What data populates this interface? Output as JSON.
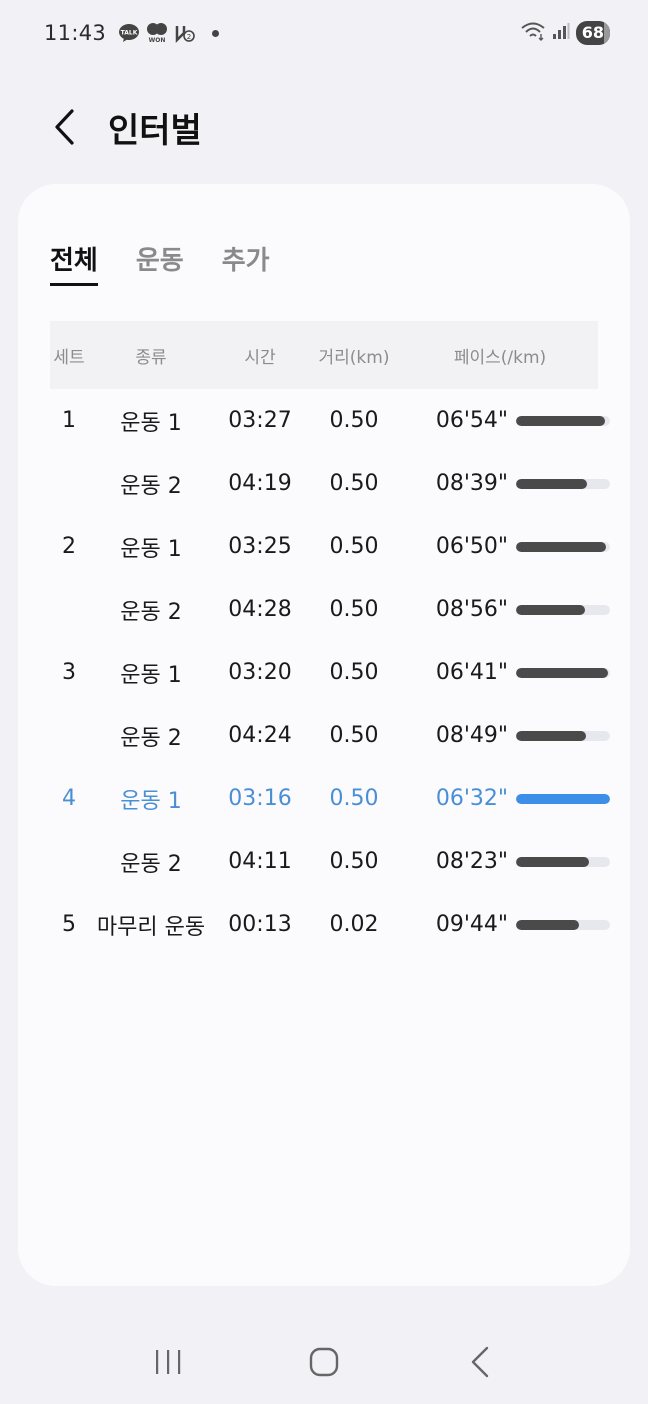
{
  "status_bar": {
    "time": "11:43",
    "notification_icons": [
      "kakaotalk-icon",
      "won-icon",
      "nfc-icon"
    ],
    "battery": "68"
  },
  "header": {
    "back_icon": "chevron-left-icon",
    "title": "인터벌"
  },
  "tabs": [
    {
      "label": "전체",
      "active": true
    },
    {
      "label": "운동",
      "active": false
    },
    {
      "label": "추가",
      "active": false
    }
  ],
  "table": {
    "headers": {
      "set": "세트",
      "type": "종류",
      "time": "시간",
      "distance": "거리(km)",
      "pace": "페이스(/km)"
    },
    "rows": [
      {
        "set": "1",
        "type": "운동 1",
        "time": "03:27",
        "distance": "0.50",
        "pace": "06'54\"",
        "pace_fraction": 0.95,
        "highlight": false
      },
      {
        "set": "",
        "type": "운동 2",
        "time": "04:19",
        "distance": "0.50",
        "pace": "08'39\"",
        "pace_fraction": 0.76,
        "highlight": false
      },
      {
        "set": "2",
        "type": "운동 1",
        "time": "03:25",
        "distance": "0.50",
        "pace": "06'50\"",
        "pace_fraction": 0.96,
        "highlight": false
      },
      {
        "set": "",
        "type": "운동 2",
        "time": "04:28",
        "distance": "0.50",
        "pace": "08'56\"",
        "pace_fraction": 0.73,
        "highlight": false
      },
      {
        "set": "3",
        "type": "운동 1",
        "time": "03:20",
        "distance": "0.50",
        "pace": "06'41\"",
        "pace_fraction": 0.98,
        "highlight": false
      },
      {
        "set": "",
        "type": "운동 2",
        "time": "04:24",
        "distance": "0.50",
        "pace": "08'49\"",
        "pace_fraction": 0.74,
        "highlight": false
      },
      {
        "set": "4",
        "type": "운동 1",
        "time": "03:16",
        "distance": "0.50",
        "pace": "06'32\"",
        "pace_fraction": 1.0,
        "highlight": true
      },
      {
        "set": "",
        "type": "운동 2",
        "time": "04:11",
        "distance": "0.50",
        "pace": "08'23\"",
        "pace_fraction": 0.78,
        "highlight": false
      },
      {
        "set": "5",
        "type": "마무리 운동",
        "time": "00:13",
        "distance": "0.02",
        "pace": "09'44\"",
        "pace_fraction": 0.67,
        "highlight": false
      }
    ]
  },
  "colors": {
    "highlight_text": "#4a8fd6",
    "highlight_bar": "#3d8ee8",
    "bar_default": "#4a4a4a",
    "bar_track": "#e6e8ee"
  },
  "nav_bar": {
    "icons": [
      "recent-apps-icon",
      "home-icon",
      "back-icon"
    ]
  }
}
